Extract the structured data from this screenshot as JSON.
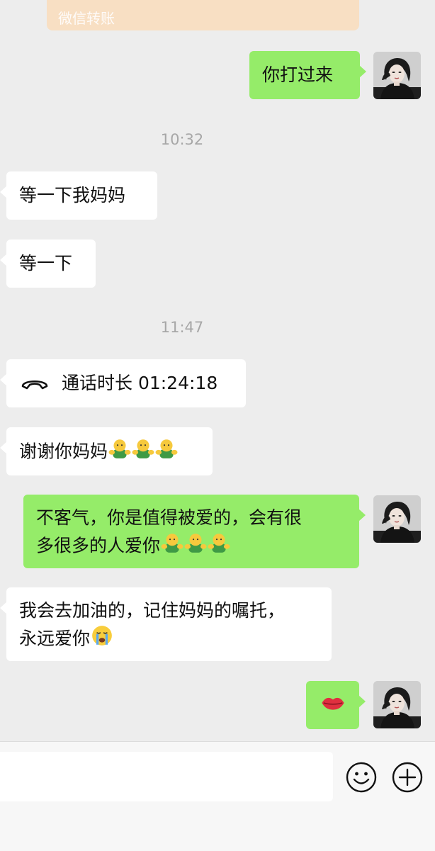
{
  "transfer": {
    "label": "微信转账"
  },
  "messages": [
    {
      "from": "me",
      "text": "你打过来"
    },
    {
      "time": "10:32"
    },
    {
      "from": "them",
      "text": "等一下我妈妈"
    },
    {
      "from": "them",
      "text": "等一下"
    },
    {
      "time": "11:47"
    },
    {
      "from": "them",
      "type": "call",
      "text": "通话时长 01:24:18"
    },
    {
      "from": "them",
      "text": "谢谢你妈妈",
      "emoji": [
        "hug-emoji",
        "hug-emoji",
        "hug-emoji"
      ]
    },
    {
      "from": "me",
      "line1": "不客气，你是值得被爱的，会有很",
      "line2": "多很多的人爱你",
      "emoji": [
        "hug-emoji",
        "hug-emoji",
        "hug-emoji"
      ]
    },
    {
      "from": "them",
      "line1": "我会去加油的，记住妈妈的嘱托，",
      "line2": "永远爱你",
      "emoji": [
        "loudly-crying-emoji"
      ]
    },
    {
      "from": "me",
      "emoji": [
        "lips-emoji"
      ]
    }
  ],
  "input_bar": {
    "icons": [
      "emoji-icon",
      "plus-icon"
    ]
  },
  "colors": {
    "background": "#ededed",
    "outgoing_bubble": "#95ec69",
    "incoming_bubble": "#ffffff",
    "transfer_card": "#f8dfc3"
  }
}
